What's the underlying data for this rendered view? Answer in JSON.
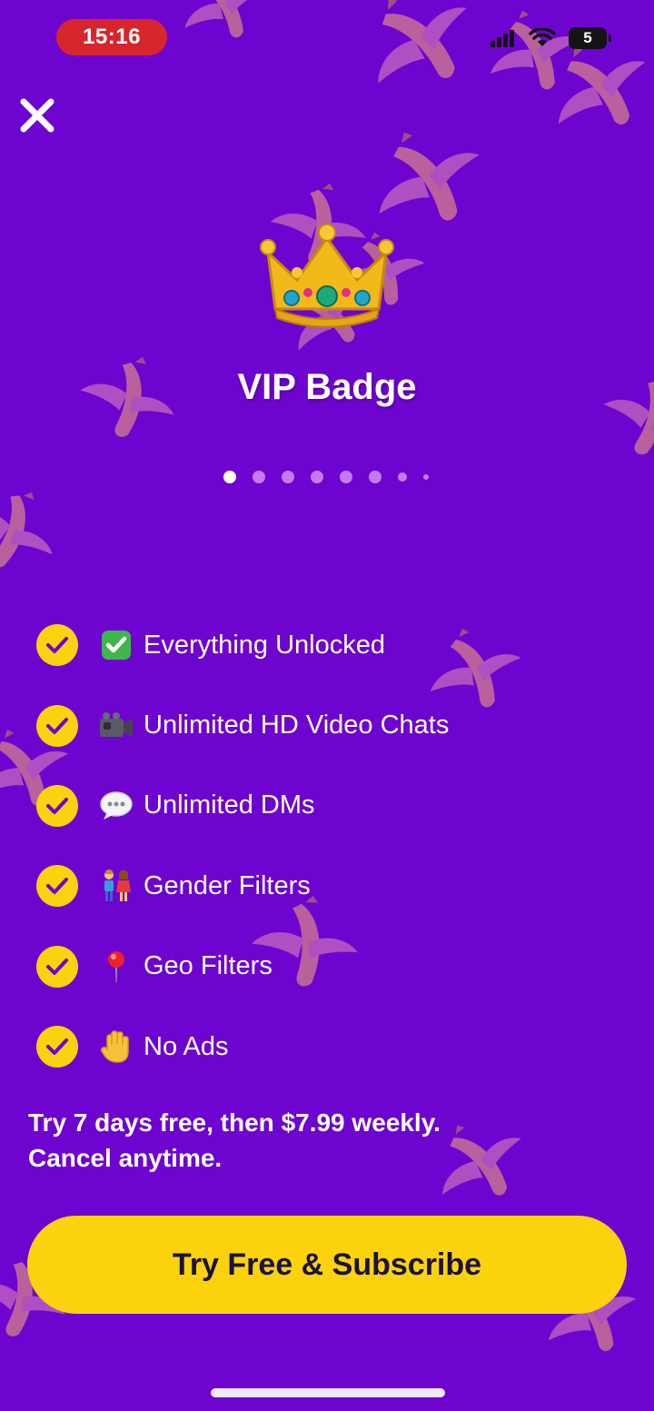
{
  "status_bar": {
    "time": "15:16",
    "battery": "5",
    "icons": [
      "signal-icon",
      "wifi-icon",
      "battery-icon"
    ]
  },
  "header": {
    "close_icon": "close-icon"
  },
  "hero": {
    "icon": "crown-icon",
    "title": "VIP Badge"
  },
  "pagination": {
    "total": 8,
    "active": 1
  },
  "features": [
    {
      "icon": "check-mark-emoji-icon",
      "label": "Everything Unlocked"
    },
    {
      "icon": "video-camera-emoji-icon",
      "label": "Unlimited HD Video Chats"
    },
    {
      "icon": "speech-bubble-emoji-icon",
      "label": "Unlimited DMs"
    },
    {
      "icon": "couple-emoji-icon",
      "label": "Gender Filters"
    },
    {
      "icon": "pin-emoji-icon",
      "label": "Geo Filters"
    },
    {
      "icon": "raised-hand-emoji-icon",
      "label": "No Ads"
    }
  ],
  "terms": {
    "line1": "Try 7 days free, then $7.99 weekly.",
    "line2": "Cancel anytime."
  },
  "cta": {
    "label": "Try Free & Subscribe"
  },
  "colors": {
    "background": "#6e04cf",
    "accent": "#fbd20c",
    "cta_text": "#1a1240",
    "status_time_bg": "#d7262b"
  }
}
